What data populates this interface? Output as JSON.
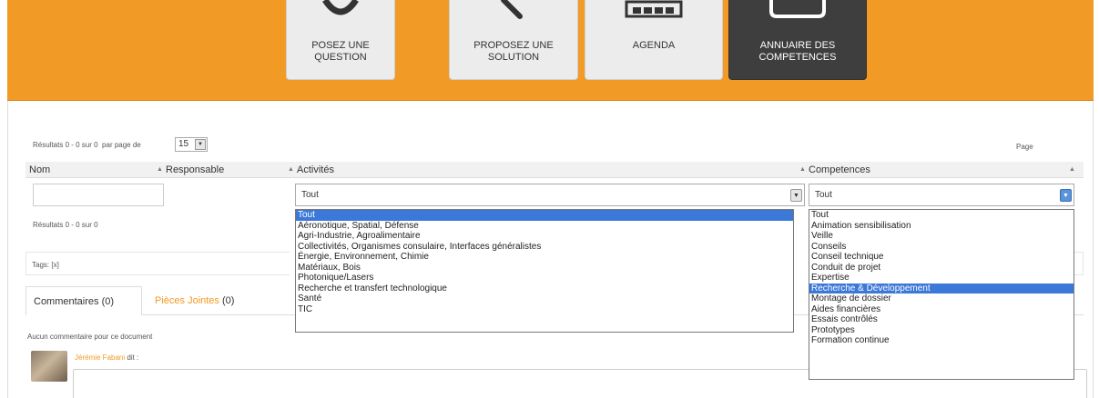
{
  "nav": {
    "tiles": [
      {
        "label_line1": "POSEZ UNE",
        "label_line2": "QUESTION",
        "icon": "search-icon"
      },
      {
        "label_line1": "PROPOSEZ UNE",
        "label_line2": "SOLUTION",
        "icon": "magnifier-handle-icon"
      },
      {
        "label_line1": "AGENDA",
        "label_line2": "",
        "icon": "calendar-icon"
      },
      {
        "label_line1": "ANNUAIRE DES",
        "label_line2": "COMPETENCES",
        "icon": "directory-icon"
      }
    ]
  },
  "results": {
    "summary_top": "Résultats 0 - 0 sur 0",
    "per_page_label": "par page de",
    "per_page_value": "15",
    "page_label": "Page",
    "summary_bottom": "Résultats 0 - 0 sur 0"
  },
  "columns": {
    "nom": "Nom",
    "responsable": "Responsable",
    "activites": "Activités",
    "competences": "Competences"
  },
  "filters": {
    "activites_value": "Tout",
    "competences_value": "Tout"
  },
  "activites_options": [
    "Tout",
    "Aéronotique, Spatial, Défense",
    "Agri-Industrie, Agroalimentaire",
    "Collectivités, Organismes consulaire, Interfaces généralistes",
    "Énergie, Environnement, Chimie",
    "Matériaux, Bois",
    "Photonique/Lasers",
    "Recherche et transfert technologique",
    "Santé",
    "TIC"
  ],
  "competences_options": [
    "Tout",
    "Animation sensibilisation",
    "Veille",
    "Conseils",
    "Conseil technique",
    "Conduit de projet",
    "Expertise",
    "Recherche & Développement",
    "Montage de dossier",
    "Aides financières",
    "Essais contrôlés",
    "Prototypes",
    "Formation continue"
  ],
  "activites_selected_index": 0,
  "competences_selected_index": 7,
  "tags": {
    "label": "Tags: [x]"
  },
  "tabs": {
    "comments_label": "Commentaires",
    "comments_count": "(0)",
    "attachments_label": "Pièces Jointes",
    "attachments_count": "(0)"
  },
  "comments": {
    "empty_text": "Aucun commentaire pour ce document",
    "author": "Jérémie Fabani",
    "author_suffix": "dit :"
  },
  "colors": {
    "accent": "#f29a26",
    "selection": "#3c78d8"
  }
}
